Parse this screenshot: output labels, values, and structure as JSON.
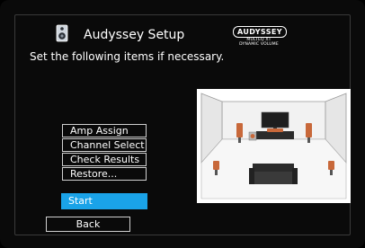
{
  "header": {
    "title": "Audyssey Setup",
    "subtitle": "Set the following items if necessary.",
    "title_icon": "speaker-icon"
  },
  "logo": {
    "brand": "AUDYSSEY",
    "line1": "MULTEQ XT",
    "line2": "DYNAMIC VOLUME"
  },
  "menu": {
    "items": [
      {
        "label": "Amp Assign"
      },
      {
        "label": "Channel Select"
      },
      {
        "label": "Check Results"
      },
      {
        "label": "Restore..."
      }
    ]
  },
  "start_label": "Start",
  "back_label": "Back",
  "colors": {
    "background": "#0a0a0a",
    "highlight": "#1aa3e8",
    "button_border": "#d0d0d0",
    "speaker": "#c8683a"
  }
}
